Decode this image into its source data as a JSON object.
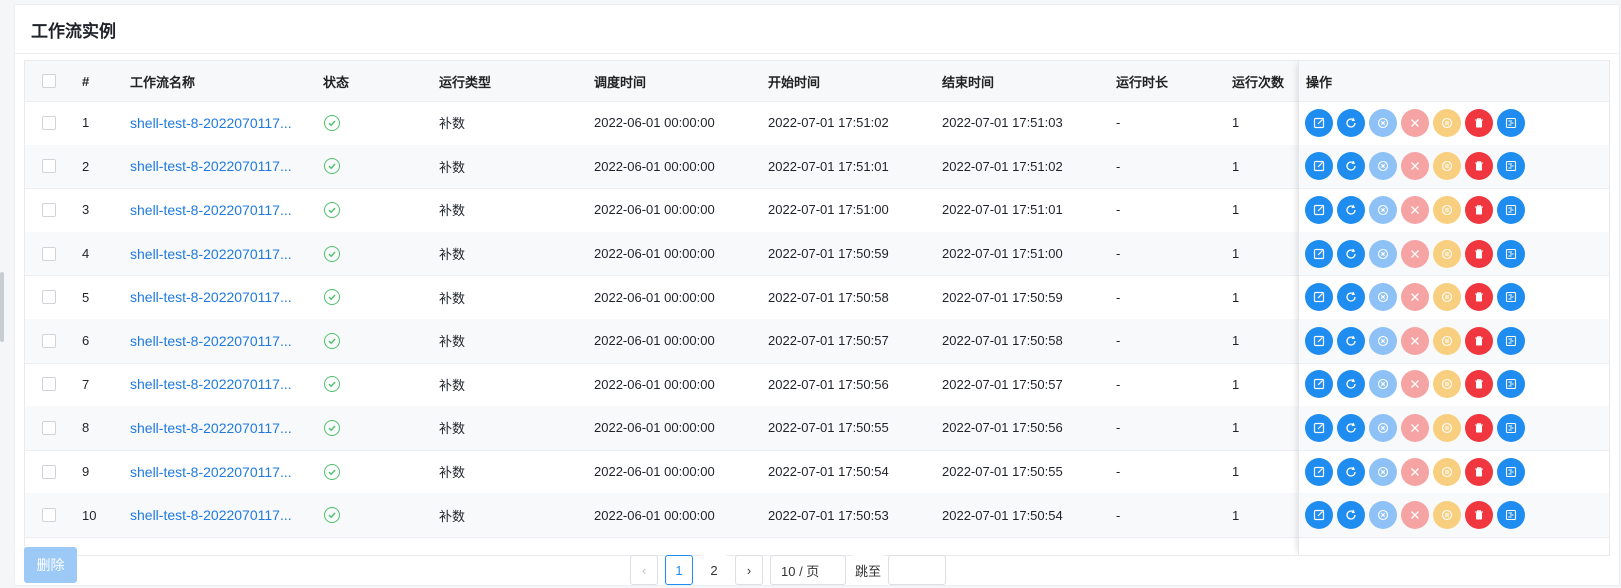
{
  "panel": {
    "title": "工作流实例"
  },
  "table": {
    "headers": {
      "index": "#",
      "name": "工作流名称",
      "state": "状态",
      "run_type": "运行类型",
      "schedule_time": "调度时间",
      "start_time": "开始时间",
      "end_time": "结束时间",
      "duration": "运行时长",
      "run_times": "运行次数",
      "operation": "操作"
    },
    "rows": [
      {
        "index": "1",
        "name": "shell-test-8-2022070117...",
        "state_icon": "success-circle-icon",
        "run_type": "补数",
        "schedule_time": "2022-06-01 00:00:00",
        "start_time": "2022-07-01 17:51:02",
        "end_time": "2022-07-01 17:51:03",
        "duration": "-",
        "run_times": "1"
      },
      {
        "index": "2",
        "name": "shell-test-8-2022070117...",
        "state_icon": "success-circle-icon",
        "run_type": "补数",
        "schedule_time": "2022-06-01 00:00:00",
        "start_time": "2022-07-01 17:51:01",
        "end_time": "2022-07-01 17:51:02",
        "duration": "-",
        "run_times": "1"
      },
      {
        "index": "3",
        "name": "shell-test-8-2022070117...",
        "state_icon": "success-circle-icon",
        "run_type": "补数",
        "schedule_time": "2022-06-01 00:00:00",
        "start_time": "2022-07-01 17:51:00",
        "end_time": "2022-07-01 17:51:01",
        "duration": "-",
        "run_times": "1"
      },
      {
        "index": "4",
        "name": "shell-test-8-2022070117...",
        "state_icon": "success-circle-icon",
        "run_type": "补数",
        "schedule_time": "2022-06-01 00:00:00",
        "start_time": "2022-07-01 17:50:59",
        "end_time": "2022-07-01 17:51:00",
        "duration": "-",
        "run_times": "1"
      },
      {
        "index": "5",
        "name": "shell-test-8-2022070117...",
        "state_icon": "success-circle-icon",
        "run_type": "补数",
        "schedule_time": "2022-06-01 00:00:00",
        "start_time": "2022-07-01 17:50:58",
        "end_time": "2022-07-01 17:50:59",
        "duration": "-",
        "run_times": "1"
      },
      {
        "index": "6",
        "name": "shell-test-8-2022070117...",
        "state_icon": "success-circle-icon",
        "run_type": "补数",
        "schedule_time": "2022-06-01 00:00:00",
        "start_time": "2022-07-01 17:50:57",
        "end_time": "2022-07-01 17:50:58",
        "duration": "-",
        "run_times": "1"
      },
      {
        "index": "7",
        "name": "shell-test-8-2022070117...",
        "state_icon": "success-circle-icon",
        "run_type": "补数",
        "schedule_time": "2022-06-01 00:00:00",
        "start_time": "2022-07-01 17:50:56",
        "end_time": "2022-07-01 17:50:57",
        "duration": "-",
        "run_times": "1"
      },
      {
        "index": "8",
        "name": "shell-test-8-2022070117...",
        "state_icon": "success-circle-icon",
        "run_type": "补数",
        "schedule_time": "2022-06-01 00:00:00",
        "start_time": "2022-07-01 17:50:55",
        "end_time": "2022-07-01 17:50:56",
        "duration": "-",
        "run_times": "1"
      },
      {
        "index": "9",
        "name": "shell-test-8-2022070117...",
        "state_icon": "success-circle-icon",
        "run_type": "补数",
        "schedule_time": "2022-06-01 00:00:00",
        "start_time": "2022-07-01 17:50:54",
        "end_time": "2022-07-01 17:50:55",
        "duration": "-",
        "run_times": "1"
      },
      {
        "index": "10",
        "name": "shell-test-8-2022070117...",
        "state_icon": "success-circle-icon",
        "run_type": "补数",
        "schedule_time": "2022-06-01 00:00:00",
        "start_time": "2022-07-01 17:50:53",
        "end_time": "2022-07-01 17:50:54",
        "duration": "-",
        "run_times": "1"
      }
    ],
    "operations": [
      {
        "name": "edit-button",
        "icon": "edit-icon",
        "color": "#1f8df0"
      },
      {
        "name": "rerun-button",
        "icon": "refresh-icon",
        "color": "#1f8df0"
      },
      {
        "name": "recover-failed-button",
        "icon": "circle-x-icon",
        "color": "#8ec2f6"
      },
      {
        "name": "stop-button",
        "icon": "close-icon",
        "color": "#f5a3a3"
      },
      {
        "name": "pause-button",
        "icon": "pause-circle-icon",
        "color": "#f7cf7f"
      },
      {
        "name": "delete-button",
        "icon": "trash-icon",
        "color": "#f0373f"
      },
      {
        "name": "gantt-button",
        "icon": "gantt-icon",
        "color": "#1f8df0"
      }
    ]
  },
  "footer": {
    "delete_label": "删除",
    "pages": [
      "1",
      "2"
    ],
    "current_page": "1",
    "page_size": "10 / 页",
    "jump_label": "跳至"
  },
  "colors": {
    "primary": "#1f8df0",
    "success": "#4fc06b",
    "danger": "#f0373f",
    "warning": "#f7cf7f"
  }
}
